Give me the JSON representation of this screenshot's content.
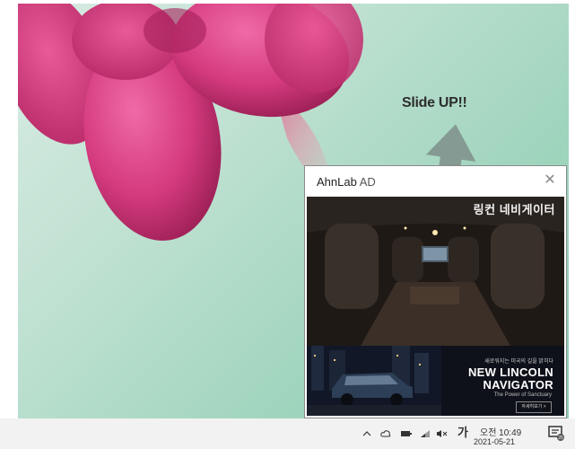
{
  "desktop": {
    "slide_label": "Slide UP!!"
  },
  "popup": {
    "title_brand": "AhnLab",
    "title_suffix": " AD",
    "close_icon": "close-icon",
    "ad": {
      "brand_text": "링컨 네비게이터",
      "small_text": "새로워지는 미국의 길을 밝히다",
      "headline_line1": "NEW LINCOLN",
      "headline_line2": "NAVIGATOR",
      "tagline": "The Power of Sanctuary",
      "cta": "자세히보기 >"
    }
  },
  "taskbar": {
    "tray_icons": [
      "chevron-up-icon",
      "cloud-icon",
      "battery-icon",
      "network-icon",
      "volume-muted-icon"
    ],
    "ime_label": "가",
    "clock_time": "오전 10:49",
    "clock_date": "2021-05-21",
    "notification_icon": "notification-icon"
  },
  "colors": {
    "wallpaper_bg": "#b7ddcc",
    "flower_pink": "#d43a7e",
    "arrow": "#7f8f89",
    "taskbar_bg": "#f2f2f2"
  }
}
